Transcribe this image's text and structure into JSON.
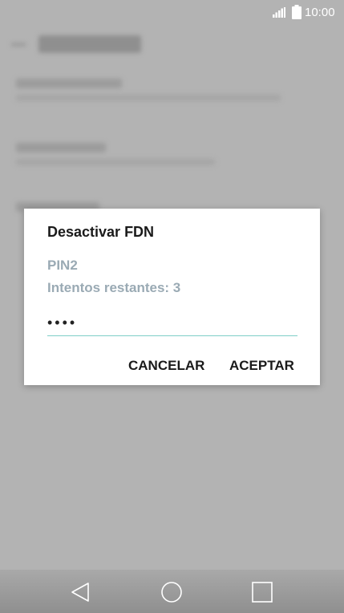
{
  "status_bar": {
    "time": "10:00"
  },
  "dialog": {
    "title": "Desactivar FDN",
    "pin_label": "PIN2",
    "attempts_label": "Intentos restantes: 3",
    "pin_value": "••••",
    "cancel_label": "CANCELAR",
    "accept_label": "ACEPTAR"
  },
  "icons": {
    "signal": "signal-icon",
    "battery": "battery-icon",
    "back": "back-icon",
    "home": "home-icon",
    "recents": "recents-icon"
  },
  "colors": {
    "accent": "#7fcfc7",
    "label": "#9aaab4",
    "scrim": "#b3b3b3"
  }
}
